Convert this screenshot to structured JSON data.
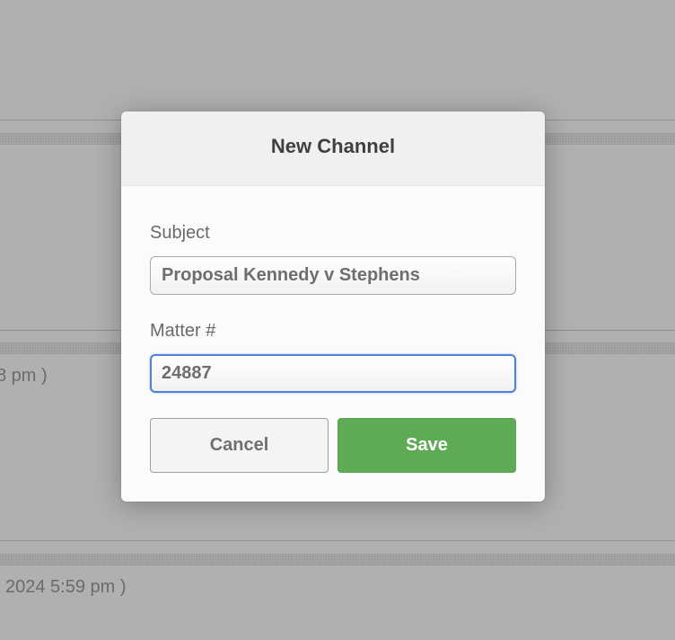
{
  "background": {
    "entries": [
      {
        "timestamp_text": "8 pm )"
      },
      {
        "timestamp_text": "2024 5:59 pm )"
      }
    ]
  },
  "dialog": {
    "title": "New Channel",
    "subject": {
      "label": "Subject",
      "value": "Proposal Kennedy v Stephens"
    },
    "matter": {
      "label": "Matter #",
      "value": "24887"
    },
    "buttons": {
      "cancel_label": "Cancel",
      "save_label": "Save"
    }
  },
  "colors": {
    "overlay": "#b0b0b0",
    "save_button": "#5faa55",
    "focus_ring": "#4d82d8"
  }
}
